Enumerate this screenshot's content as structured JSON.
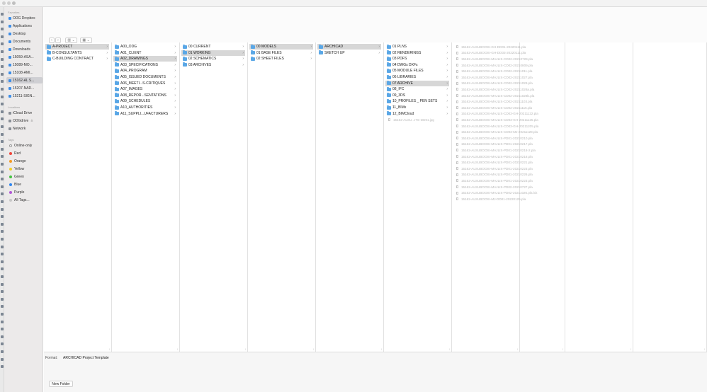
{
  "sidebar": {
    "favorites_header": "Favorites",
    "favorites": [
      {
        "label": "ODG Dropbox",
        "icon": "dropbox-icon"
      },
      {
        "label": "Applications",
        "icon": "applications-icon"
      },
      {
        "label": "Desktop",
        "icon": "desktop-icon"
      },
      {
        "label": "Documents",
        "icon": "documents-icon"
      },
      {
        "label": "Downloads",
        "icon": "downloads-icon"
      },
      {
        "label": "15059-ASA...",
        "icon": "folder-icon"
      },
      {
        "label": "15089-MO...",
        "icon": "folder-icon"
      },
      {
        "label": "15108-AMI...",
        "icon": "folder-icon"
      },
      {
        "label": "15162-AL S...",
        "icon": "folder-icon",
        "selected": true
      },
      {
        "label": "15207-NAD...",
        "icon": "folder-icon"
      },
      {
        "label": "15211-SIGN...",
        "icon": "folder-icon"
      }
    ],
    "locations_header": "Locations",
    "locations": [
      {
        "label": "iCloud Drive",
        "icon": "icloud-icon"
      },
      {
        "label": "ODGdrive",
        "icon": "drive-icon",
        "eject": "≜"
      },
      {
        "label": "Network",
        "icon": "network-icon"
      }
    ],
    "tags_header": "Tags",
    "tags": [
      {
        "label": "Online-only",
        "color": "#ffffff"
      },
      {
        "label": "Red",
        "color": "#f0443a"
      },
      {
        "label": "Orange",
        "color": "#f59a23"
      },
      {
        "label": "Yellow",
        "color": "#f4cf2a"
      },
      {
        "label": "Green",
        "color": "#45c241"
      },
      {
        "label": "Blue",
        "color": "#2f86f0"
      },
      {
        "label": "Purple",
        "color": "#b157d6"
      },
      {
        "label": "All Tags...",
        "color": "#c8c8c8"
      }
    ]
  },
  "toolbar": {
    "back": "‹",
    "forward": "›",
    "view_mode": "▥ ⌄",
    "group_mode": "▦ ⌄"
  },
  "columns": [
    {
      "items": [
        {
          "label": "A-PROJECT",
          "selected": true
        },
        {
          "label": "B-CONSULTANTS"
        },
        {
          "label": "C-BUILDING CONTRACT"
        }
      ]
    },
    {
      "items": [
        {
          "label": "A00_ODG"
        },
        {
          "label": "A01_CLIENT"
        },
        {
          "label": "A02_DRAWINGS",
          "selected": true
        },
        {
          "label": "A03_SPECIFICATIONS"
        },
        {
          "label": "A04_PROGRAM"
        },
        {
          "label": "A05_ISSUED DOCUMENTS"
        },
        {
          "label": "A06_MEETI...S-CRITIQUES"
        },
        {
          "label": "A07_IMAGES"
        },
        {
          "label": "A08_REPOR...SENTATIONS"
        },
        {
          "label": "A09_SCHEDULES"
        },
        {
          "label": "A10_AUTHORITIES"
        },
        {
          "label": "A11_SUPPLI...UFACTURERS"
        }
      ]
    },
    {
      "items": [
        {
          "label": "00 CURRENT"
        },
        {
          "label": "01 WORKING",
          "selected": true
        },
        {
          "label": "02 SCHEMATICS"
        },
        {
          "label": "03 ARCHIVES"
        }
      ]
    },
    {
      "items": [
        {
          "label": "00 MODELS",
          "selected": true
        },
        {
          "label": "01 BASE FILES"
        },
        {
          "label": "02 SHEET FILES"
        }
      ]
    },
    {
      "items": [
        {
          "label": "ARCHICAD",
          "selected": true
        },
        {
          "label": "SKETCH UP"
        }
      ]
    },
    {
      "items": [
        {
          "label": "01 PLNS"
        },
        {
          "label": "02 RENDERINGS"
        },
        {
          "label": "03 PDFS"
        },
        {
          "label": "04 DWGs DXFs"
        },
        {
          "label": "05 MODULE FILES"
        },
        {
          "label": "06 LIBRARIES"
        },
        {
          "label": "07 ARCHIVE",
          "selected": true
        },
        {
          "label": "08_IFC"
        },
        {
          "label": "09_3DS"
        },
        {
          "label": "10_PROFILES _ PEN SETS"
        },
        {
          "label": "11_BIMx"
        },
        {
          "label": "12_BIMCloud"
        }
      ],
      "files": [
        "15162-ALSU...ITE-DD01.jpg"
      ]
    }
  ],
  "archive_files": [
    "15162-ALSUBOOSI-GH-DD01-20220111.pla",
    "15162-ALSUBOOSI-GH-DD03-20220111.pla",
    "15162-ALSUBOOSI-MAJLIS-CD02-20210729.pla",
    "15162-ALSUBOOSI-MAJLIS-CD02-20210809.pla",
    "15162-ALSUBOOSI-MAJLIS-CD02-20211011.pla",
    "15162-ALSUBOOSI-MAJLIS-CD02-20211027.pla",
    "15162-ALSUBOOSI-MAJLIS-CD02-20211028.pla",
    "15162-ALSUBOOSI-MAJLIS-CD02-20211028a.pla",
    "15162-ALSUBOOSI-MAJLIS-CD02-20211028b.pla",
    "15162-ALSUBOOSI-MAJLIS-CD02-20211103.pla",
    "15162-ALSUBOOSI-MAJLIS-CD02-20211115.pla",
    "15162-ALSUBOOSI-MAJLIS-CD03-GH-20211122.pla",
    "15162-ALSUBOOSI-MAJLIS-CD03-GH-20211125.pla",
    "15162-ALSUBOOSI-MAJLIS-CD03-GH-20211205.pla",
    "15162-ALSUBOOSI-MAJLIS-CD03-MJ-20211128.pla",
    "15162-ALSUBOOSI-MAJLIS-PD01-20210210.pla",
    "15162-ALSUBOOSI-MAJLIS-PD01-20210217.pla",
    "15162-ALSUBOOSI-MAJLIS-PD01-20210218-2.pla",
    "15162-ALSUBOOSI-MAJLIS-PD01-20210218.pla",
    "15162-ALSUBOOSI-MAJLIS-PD01-20210221.pla",
    "15162-ALSUBOOSI-MAJLIS-PD01-20210223.pla",
    "15162-ALSUBOOSI-MAJLIS-PD01-20210226.pla",
    "15162-ALSUBOOSI-MAJLIS-PD01-20210223.pla",
    "15162-ALSUBOOSI-MAJLIS-PD02-20210727.pla",
    "15162-ALSUBOOSI-MAJLIS-PD02-20211026.pla.lck",
    "15162-ALSUBOOSI-MJ-DD01-20220125.pla"
  ],
  "bottom": {
    "format_label": "Format:",
    "format_value": "ARCHICAD Project Template",
    "new_folder": "New Folder"
  },
  "colors": {
    "accent": "#5aa7e6",
    "selection": "#d7d7d7",
    "sidebar_bg": "#eceaea"
  }
}
